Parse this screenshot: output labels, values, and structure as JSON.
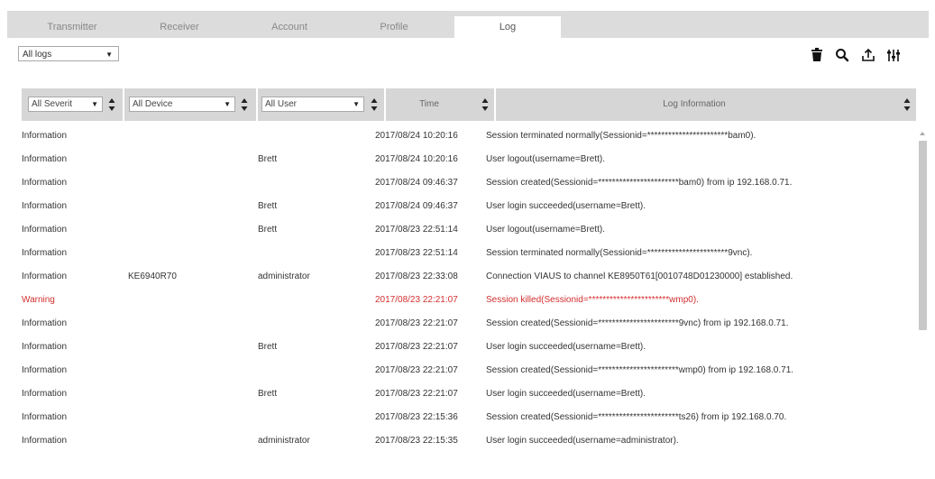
{
  "tabs": [
    {
      "label": "Transmitter"
    },
    {
      "label": "Receiver"
    },
    {
      "label": "Account"
    },
    {
      "label": "Profile"
    },
    {
      "label": "Log"
    }
  ],
  "active_tab": "Log",
  "toolbar": {
    "log_filter": {
      "selected": "All logs"
    },
    "icons": [
      "trash-icon",
      "search-icon",
      "export-icon",
      "settings-sliders-icon"
    ]
  },
  "columns": {
    "severity": {
      "selected": "All Severit"
    },
    "device": {
      "selected": "All Device"
    },
    "user": {
      "selected": "All User"
    },
    "time": {
      "label": "Time"
    },
    "info": {
      "label": "Log Information"
    }
  },
  "rows": [
    {
      "severity": "Information",
      "device": "",
      "user": "",
      "time": "2017/08/24 10:20:16",
      "info": "Session terminated normally(Sessionid=***********************bam0)."
    },
    {
      "severity": "Information",
      "device": "",
      "user": "Brett",
      "time": "2017/08/24 10:20:16",
      "info": "User logout(username=Brett)."
    },
    {
      "severity": "Information",
      "device": "",
      "user": "",
      "time": "2017/08/24 09:46:37",
      "info": "Session created(Sessionid=***********************bam0) from ip 192.168.0.71."
    },
    {
      "severity": "Information",
      "device": "",
      "user": "Brett",
      "time": "2017/08/24 09:46:37",
      "info": "User login succeeded(username=Brett)."
    },
    {
      "severity": "Information",
      "device": "",
      "user": "Brett",
      "time": "2017/08/23 22:51:14",
      "info": "User logout(username=Brett)."
    },
    {
      "severity": "Information",
      "device": "",
      "user": "",
      "time": "2017/08/23 22:51:14",
      "info": "Session terminated normally(Sessionid=***********************9vnc)."
    },
    {
      "severity": "Information",
      "device": "KE6940R70",
      "user": "administrator",
      "time": "2017/08/23 22:33:08",
      "info": "Connection VIAUS to channel KE8950T61[0010748D01230000] established."
    },
    {
      "severity": "Warning",
      "device": "",
      "user": "",
      "time": "2017/08/23 22:21:07",
      "info": "Session killed(Sessionid=***********************wmp0)."
    },
    {
      "severity": "Information",
      "device": "",
      "user": "",
      "time": "2017/08/23 22:21:07",
      "info": "Session created(Sessionid=***********************9vnc) from ip 192.168.0.71."
    },
    {
      "severity": "Information",
      "device": "",
      "user": "Brett",
      "time": "2017/08/23 22:21:07",
      "info": "User login succeeded(username=Brett)."
    },
    {
      "severity": "Information",
      "device": "",
      "user": "",
      "time": "2017/08/23 22:21:07",
      "info": "Session created(Sessionid=***********************wmp0) from ip 192.168.0.71."
    },
    {
      "severity": "Information",
      "device": "",
      "user": "Brett",
      "time": "2017/08/23 22:21:07",
      "info": "User login succeeded(username=Brett)."
    },
    {
      "severity": "Information",
      "device": "",
      "user": "",
      "time": "2017/08/23 22:15:36",
      "info": "Session created(Sessionid=***********************ts26) from ip 192.168.0.70."
    },
    {
      "severity": "Information",
      "device": "",
      "user": "administrator",
      "time": "2017/08/23 22:15:35",
      "info": "User login succeeded(username=administrator)."
    }
  ],
  "colors": {
    "warning": "#d32f2f",
    "tabbar": "#dcdcdc",
    "header": "#d6d6d6"
  }
}
